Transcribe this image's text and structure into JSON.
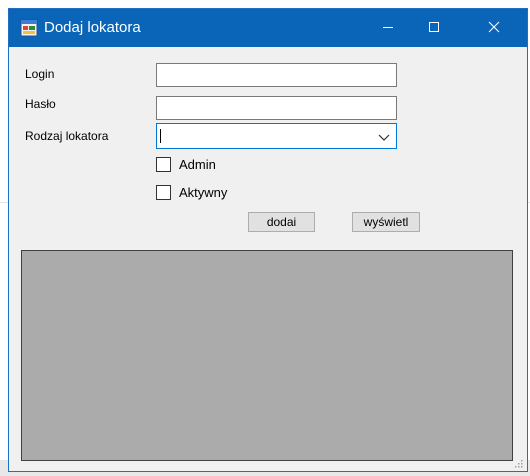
{
  "window": {
    "title": "Dodaj lokatora",
    "icons": {
      "app": "app-form-icon",
      "minimize": "minimize-icon",
      "maximize": "maximize-icon",
      "close": "close-icon"
    }
  },
  "form": {
    "login_label": "Login",
    "login_value": "",
    "password_label": "Hasło",
    "password_value": "",
    "type_label": "Rodzaj lokatora",
    "type_value": "",
    "admin_label": "Admin",
    "admin_checked": false,
    "active_label": "Aktywny",
    "active_checked": false
  },
  "buttons": {
    "add_label": "dodai",
    "show_label": "wyświetl"
  },
  "colors": {
    "titlebar": "#0a64b8",
    "window_bg": "#f0f0f0",
    "grid_bg": "#ababab",
    "focus_border": "#0078d7"
  }
}
